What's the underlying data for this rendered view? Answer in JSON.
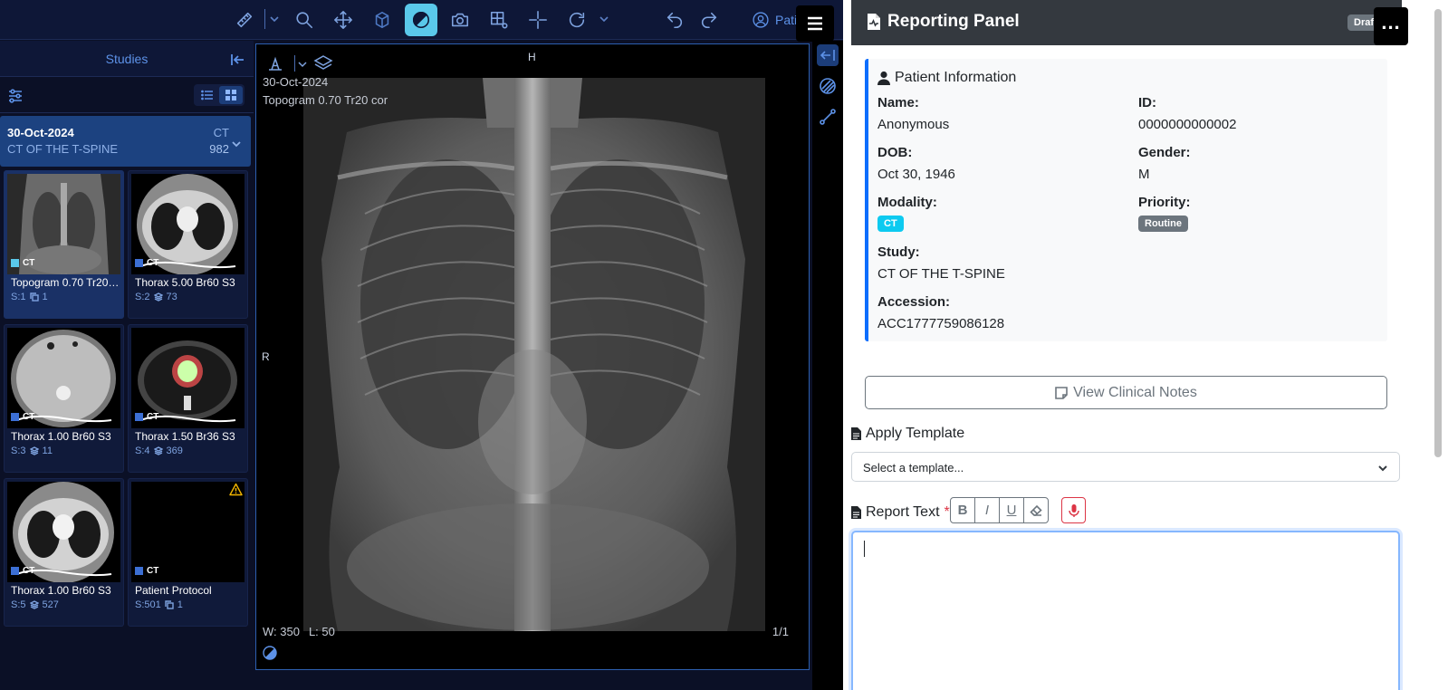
{
  "toolbar": {
    "patient_label": "Patient"
  },
  "studies": {
    "title": "Studies",
    "study": {
      "date": "30-Oct-2024",
      "description": "CT OF THE T-SPINE",
      "modality": "CT",
      "count": "982"
    },
    "series": [
      {
        "modality": "CT",
        "label": "Topogram 0.70 Tr20 cor",
        "number": "S:1",
        "images": "1"
      },
      {
        "modality": "CT",
        "label": "Thorax 5.00 Br60 S3",
        "number": "S:2",
        "images": "73"
      },
      {
        "modality": "CT",
        "label": "Thorax 1.00 Br60 S3",
        "number": "S:3",
        "images": "11"
      },
      {
        "modality": "CT",
        "label": "Thorax 1.50 Br36 S3",
        "number": "S:4",
        "images": "369"
      },
      {
        "modality": "CT",
        "label": "Thorax 1.00 Br60 S3",
        "number": "S:5",
        "images": "527"
      },
      {
        "modality": "CT",
        "label": "Patient Protocol",
        "number": "S:501",
        "images": "1"
      }
    ]
  },
  "viewport": {
    "orientation_top": "H",
    "orientation_left": "R",
    "date": "30-Oct-2024",
    "series": "Topogram 0.70 Tr20 cor",
    "window": "W: 350",
    "level": "L: 50",
    "frames": "1/1"
  },
  "report": {
    "title": "Reporting Panel",
    "status": "Draft",
    "patient": {
      "section_title": "Patient Information",
      "name_label": "Name:",
      "name": "Anonymous",
      "id_label": "ID:",
      "id": "0000000000002",
      "dob_label": "DOB:",
      "dob": "Oct 30, 1946",
      "gender_label": "Gender:",
      "gender": "M",
      "modality_label": "Modality:",
      "modality": "CT",
      "priority_label": "Priority:",
      "priority": "Routine",
      "study_label": "Study:",
      "study": "CT OF THE T-SPINE",
      "accession_label": "Accession:",
      "accession": "ACC1777759086128"
    },
    "notes_button": "View Clinical Notes",
    "template_label": "Apply Template",
    "template_placeholder": "Select a template...",
    "report_text_label": "Report Text",
    "required_mark": "*",
    "format": {
      "bold": "B",
      "italic": "I",
      "underline": "U"
    },
    "report_text": ""
  },
  "colors": {
    "viewer_bg": "#0b1026",
    "accent": "#5ac8ea",
    "link_blue": "#5d92e8",
    "card_border": "#0d6efd",
    "badge_ct": "#0dcaf0",
    "badge_routine": "#6c757d"
  }
}
